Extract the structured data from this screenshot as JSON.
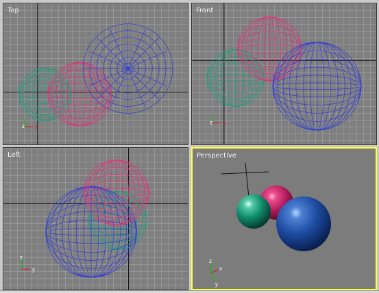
{
  "viewports": {
    "top": {
      "label": "Top"
    },
    "front": {
      "label": "Front"
    },
    "left": {
      "label": "Left"
    },
    "perspective": {
      "label": "Perspective"
    }
  },
  "axes": {
    "top": [
      "x",
      "z"
    ],
    "front": [
      "x",
      "z"
    ],
    "left": [
      "y",
      "z"
    ],
    "perspective": [
      "x",
      "z",
      "y"
    ]
  },
  "colors": {
    "active_border": "#ffff34",
    "teal_sphere": "#1ea07e",
    "pink_sphere": "#e0337b",
    "blue_sphere": "#2d3bd7"
  }
}
